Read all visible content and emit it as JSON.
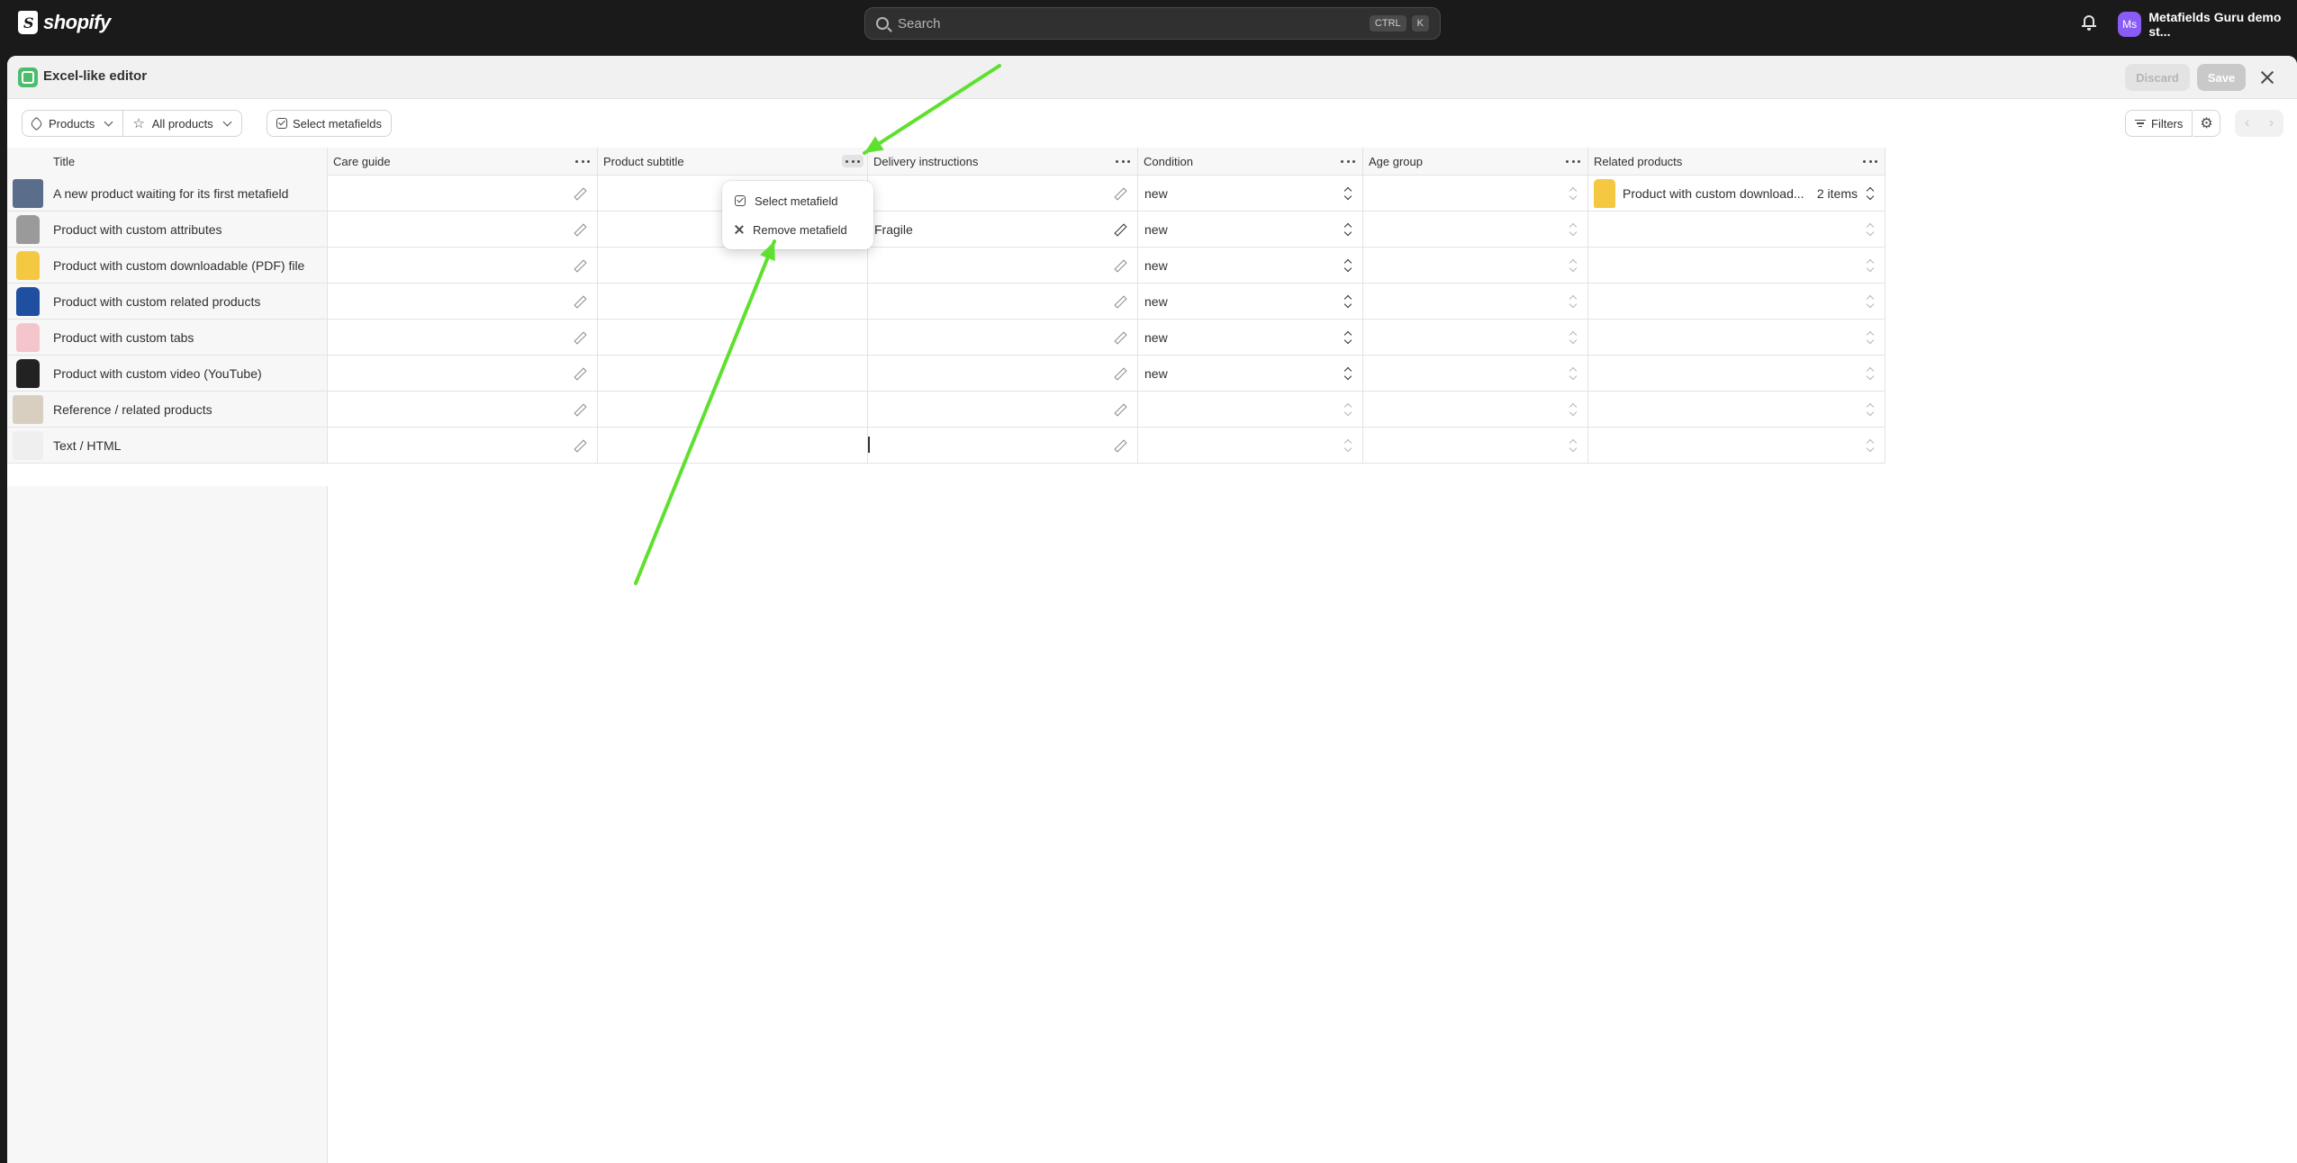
{
  "topbar": {
    "logo_text": "shopify",
    "search_placeholder": "Search",
    "shortcut_ctrl": "CTRL",
    "shortcut_k": "K",
    "avatar_initials": "Ms",
    "store_name": "Metafields Guru demo st..."
  },
  "app": {
    "title": "Excel-like editor",
    "discard_label": "Discard",
    "save_label": "Save"
  },
  "toolbar": {
    "resource_label": "Products",
    "view_label": "All products",
    "select_metafields_label": "Select metafields",
    "filters_label": "Filters"
  },
  "columns": [
    "Title",
    "Care guide",
    "Product subtitle",
    "Delivery instructions",
    "Condition",
    "Age group",
    "Related products"
  ],
  "rows": [
    {
      "title": "A new product waiting for its first metafield",
      "delivery": "",
      "condition": "new",
      "related": "Product with custom download...",
      "related_count": "2 items"
    },
    {
      "title": "Product with custom attributes",
      "delivery": "Fragile",
      "condition": "new",
      "related": "",
      "related_count": ""
    },
    {
      "title": "Product with custom downloadable (PDF) file",
      "delivery": "",
      "condition": "new",
      "related": "",
      "related_count": ""
    },
    {
      "title": "Product with custom related products",
      "delivery": "",
      "condition": "new",
      "related": "",
      "related_count": ""
    },
    {
      "title": "Product with custom tabs",
      "delivery": "",
      "condition": "new",
      "related": "",
      "related_count": ""
    },
    {
      "title": "Product with custom video (YouTube)",
      "delivery": "",
      "condition": "new",
      "related": "",
      "related_count": ""
    },
    {
      "title": "Reference / related products",
      "delivery": "",
      "condition": "",
      "related": "",
      "related_count": ""
    },
    {
      "title": "Text / HTML",
      "delivery": "",
      "condition": "",
      "related": "",
      "related_count": ""
    }
  ],
  "thumb_colors": [
    "#5a6e8c",
    "#9a9a9a",
    "#f5c842",
    "#1f4fa0",
    "#f4c6cc",
    "#222222",
    "#d9cfc0",
    "#efefef"
  ],
  "column_menu": {
    "select_label": "Select metafield",
    "remove_label": "Remove metafield"
  },
  "accent_color": "#5ee02e"
}
